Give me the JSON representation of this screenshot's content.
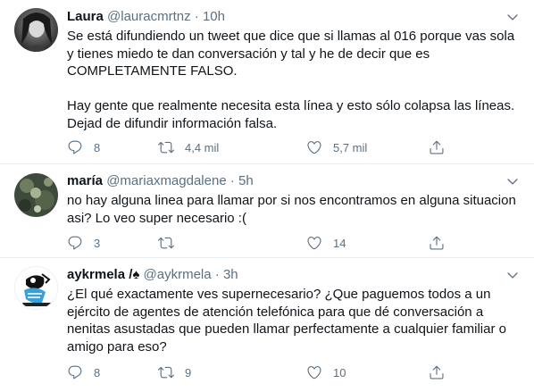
{
  "tweets": [
    {
      "name": "Laura",
      "handle": "@lauracmrtnz",
      "time": "10h",
      "text": "Se está difundiendo un tweet que dice que si llamas al 016 porque vas sola y tienes miedo te dan conversación y tal y he de decir que es COMPLETAMENTE FALSO.\n\nHay gente que realmente necesita esta línea y esto sólo colapsa las líneas. Dejad de difundir información falsa.",
      "replies": "8",
      "retweets": "4,4 mil",
      "likes": "5,7 mil"
    },
    {
      "name": "maría",
      "handle": "@mariaxmagdalene",
      "time": "5h",
      "text": "no hay alguna linea para llamar por si nos encontramos en alguna situacion asi? Lo veo super necesario :(",
      "replies": "3",
      "retweets": "",
      "likes": "14"
    },
    {
      "name": "aykrmela /♠",
      "handle": "@aykrmela",
      "time": "3h",
      "text": "¿El qué exactamente ves supernecesario? ¿Que paguemos todos a un ejército de agentes de atención telefónica para que dé conversación a nenitas asustadas que pueden llamar perfectamente a cualquier familiar o amigo para eso?",
      "replies": "8",
      "retweets": "9",
      "likes": "10"
    }
  ],
  "separator": "·",
  "icons": {
    "reply": "reply-icon",
    "retweet": "retweet-icon",
    "like": "heart-icon",
    "share": "share-icon",
    "more": "chevron-down-icon"
  },
  "colors": {
    "text": "#0f1419",
    "secondary": "#5b7083",
    "divider": "#e6ecf0"
  }
}
